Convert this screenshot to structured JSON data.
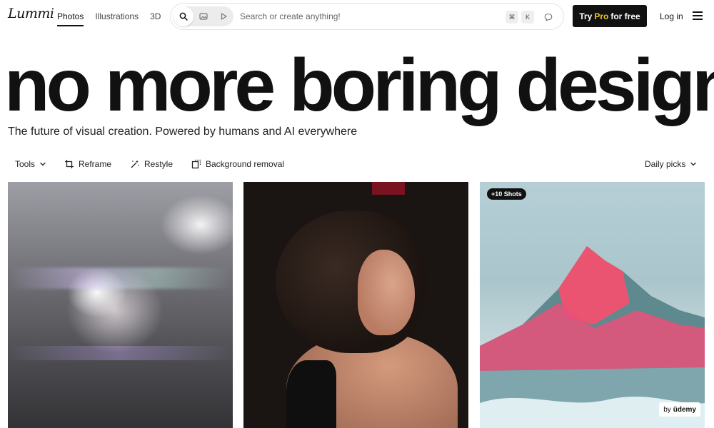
{
  "logo": {
    "text": "Lummi"
  },
  "nav": {
    "items": [
      "Photos",
      "Illustrations",
      "3D"
    ],
    "active": "Photos"
  },
  "search": {
    "placeholder": "Search or create anything!",
    "shortcut_keys": [
      "⌘",
      "K"
    ],
    "modes": [
      "search-icon",
      "image-icon",
      "play-icon"
    ]
  },
  "header": {
    "pro_prefix": "Try",
    "pro_word": "Pro",
    "pro_suffix": "for free",
    "login_label": "Log in"
  },
  "hero": {
    "title": "no more boring design",
    "subtitle": "The future of visual creation. Powered by humans and AI everywhere"
  },
  "toolbar": {
    "tools_label": "Tools",
    "reframe_label": "Reframe",
    "restyle_label": "Restyle",
    "bg_removal_label": "Background removal",
    "sort_label": "Daily picks"
  },
  "cards": [
    {
      "description": "abstract crystal light",
      "badge": ""
    },
    {
      "description": "woman portrait",
      "badge": ""
    },
    {
      "description": "pink mountain",
      "badge": "+10 Shots",
      "sponsor_prefix": "by",
      "sponsor": "ūdemy"
    }
  ],
  "colors": {
    "primary_button": "#111111",
    "pro_accent": "#f5c518"
  }
}
